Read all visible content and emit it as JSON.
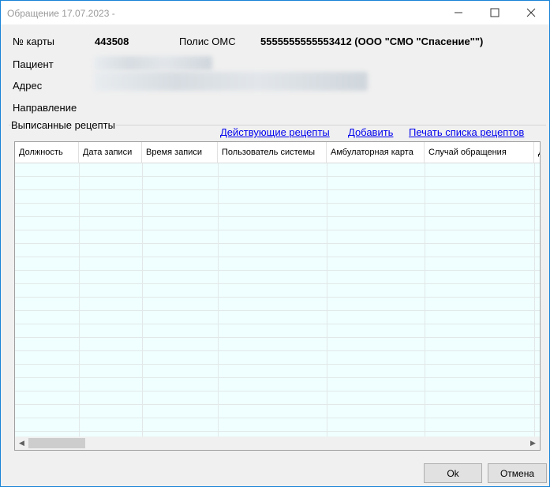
{
  "window": {
    "title": "Обращение 17.07.2023 -",
    "controls": {
      "minimize": "minimize-icon",
      "maximize": "maximize-icon",
      "close": "close-icon"
    }
  },
  "info": {
    "card_label": "№ карты",
    "card_value": "443508",
    "policy_label": "Полис ОМС",
    "policy_value": "5555555555553412 (ООО \"СМО \"Спасение\"\")",
    "patient_label": "Пациент",
    "address_label": "Адрес",
    "referral_label": "Направление"
  },
  "prescriptions": {
    "group_title": "Выписанные рецепты",
    "links": {
      "active": "Действующие рецепты",
      "add": "Добавить",
      "print": "Печать списка рецептов"
    },
    "columns": [
      "Должность",
      "Дата записи",
      "Время записи",
      "Пользователь системы",
      "Амбулаторная карта",
      "Случай обращения",
      "Д"
    ],
    "rows": []
  },
  "buttons": {
    "ok": "Ok",
    "cancel": "Отмена"
  },
  "colors": {
    "accent_border": "#1883d7",
    "grid_background": "#f0ffff",
    "link": "#0000ee"
  }
}
